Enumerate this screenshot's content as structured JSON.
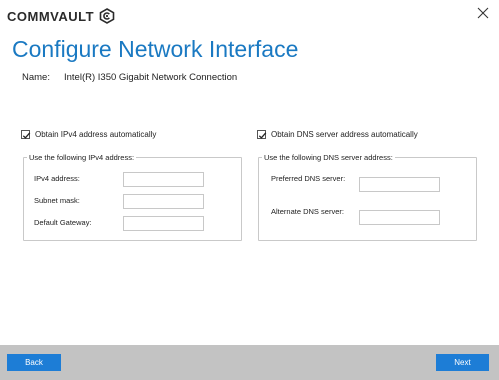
{
  "brand": {
    "logo_text": "COMMVAULT",
    "logo_icon": "commvault-hex-logo"
  },
  "window": {
    "close_icon": "close-icon"
  },
  "page": {
    "title": "Configure Network Interface",
    "name_label": "Name:",
    "name_value": "Intel(R) I350 Gigabit Network Connection"
  },
  "ipv4": {
    "auto_checkbox_label": "Obtain IPv4 address automatically",
    "auto_checked": true,
    "group_legend": "Use the following IPv4 address:",
    "fields": [
      {
        "label": "IPv4 address:",
        "value": ""
      },
      {
        "label": "Subnet mask:",
        "value": ""
      },
      {
        "label": "Default Gateway:",
        "value": ""
      }
    ]
  },
  "dns": {
    "auto_checkbox_label": "Obtain DNS server address automatically",
    "auto_checked": true,
    "group_legend": "Use the following DNS server address:",
    "fields": [
      {
        "label": "Preferred DNS server:",
        "value": ""
      },
      {
        "label": "Alternate DNS server:",
        "value": ""
      }
    ]
  },
  "footer": {
    "back_label": "Back",
    "next_label": "Next"
  },
  "colors": {
    "accent": "#1a79c2",
    "button": "#1d7dd6",
    "footer_bg": "#c3c3c3"
  }
}
